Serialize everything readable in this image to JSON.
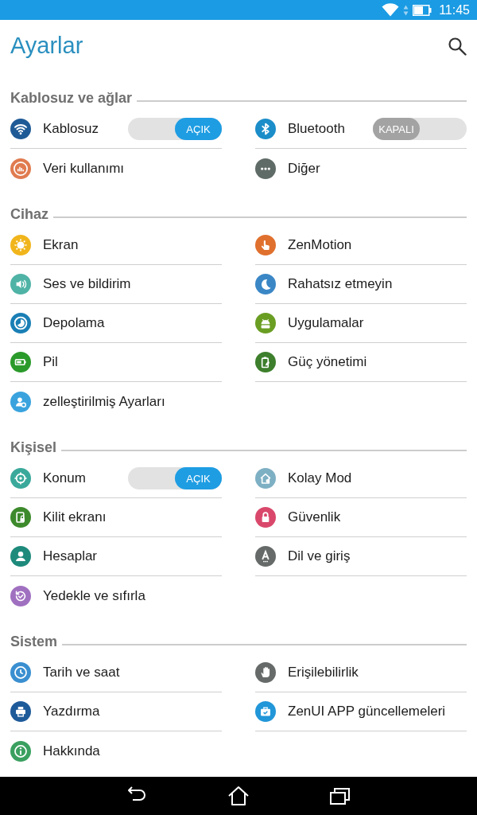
{
  "status_bar": {
    "time": "11:45"
  },
  "app_bar": {
    "title": "Ayarlar"
  },
  "sections": [
    {
      "title": "Kablosuz ve ağlar",
      "items": [
        {
          "label": "Kablosuz",
          "kind": "toggle",
          "color": "#1e5a96",
          "toggle": {
            "label": "AÇIK",
            "on": true
          }
        },
        {
          "label": "Bluetooth",
          "kind": "toggle",
          "color": "#1b8dc9",
          "toggle": {
            "label": "KAPALI",
            "on": false
          }
        },
        {
          "label": "Veri kullanımı",
          "kind": "link",
          "color": "#e07b4f"
        },
        {
          "label": "Diğer",
          "kind": "link",
          "color": "#5f6b66"
        }
      ]
    },
    {
      "title": "Cihaz",
      "items": [
        {
          "label": "Ekran",
          "kind": "link",
          "color": "#f1b51c"
        },
        {
          "label": "ZenMotion",
          "kind": "link",
          "color": "#e0702e"
        },
        {
          "label": "Ses ve bildirim",
          "kind": "link",
          "color": "#4fb3a6"
        },
        {
          "label": "Rahatsız etmeyin",
          "kind": "link",
          "color": "#3b87c6"
        },
        {
          "label": "Depolama",
          "kind": "link",
          "color": "#1a7fb5"
        },
        {
          "label": "Uygulamalar",
          "kind": "link",
          "color": "#6a9e23"
        },
        {
          "label": "Pil",
          "kind": "link",
          "color": "#2a9a2a"
        },
        {
          "label": "Güç yönetimi",
          "kind": "link",
          "color": "#3d7f2c"
        },
        {
          "label": "zelleştirilmiş Ayarları",
          "kind": "link",
          "color": "#3aa3de"
        }
      ]
    },
    {
      "title": "Kişisel",
      "items": [
        {
          "label": "Konum",
          "kind": "toggle",
          "color": "#3aa99b",
          "toggle": {
            "label": "AÇIK",
            "on": true
          }
        },
        {
          "label": "Kolay Mod",
          "kind": "link",
          "color": "#7eb0c4"
        },
        {
          "label": "Kilit ekranı",
          "kind": "link",
          "color": "#3d8a2c"
        },
        {
          "label": "Güvenlik",
          "kind": "link",
          "color": "#d9486b"
        },
        {
          "label": "Hesaplar",
          "kind": "link",
          "color": "#1e8a7c"
        },
        {
          "label": "Dil ve giriş",
          "kind": "link",
          "color": "#666b6a"
        },
        {
          "label": "Yedekle ve sıfırla",
          "kind": "link",
          "color": "#a070c0"
        }
      ]
    },
    {
      "title": "Sistem",
      "items": [
        {
          "label": "Tarih ve saat",
          "kind": "link",
          "color": "#3a8fd0"
        },
        {
          "label": "Erişilebilirlik",
          "kind": "link",
          "color": "#666b6a"
        },
        {
          "label": "Yazdırma",
          "kind": "link",
          "color": "#1d5a9a"
        },
        {
          "label": "ZenUI APP güncellemeleri",
          "kind": "link",
          "color": "#2196d8"
        },
        {
          "label": "Hakkında",
          "kind": "link",
          "color": "#3aa060"
        }
      ]
    }
  ]
}
